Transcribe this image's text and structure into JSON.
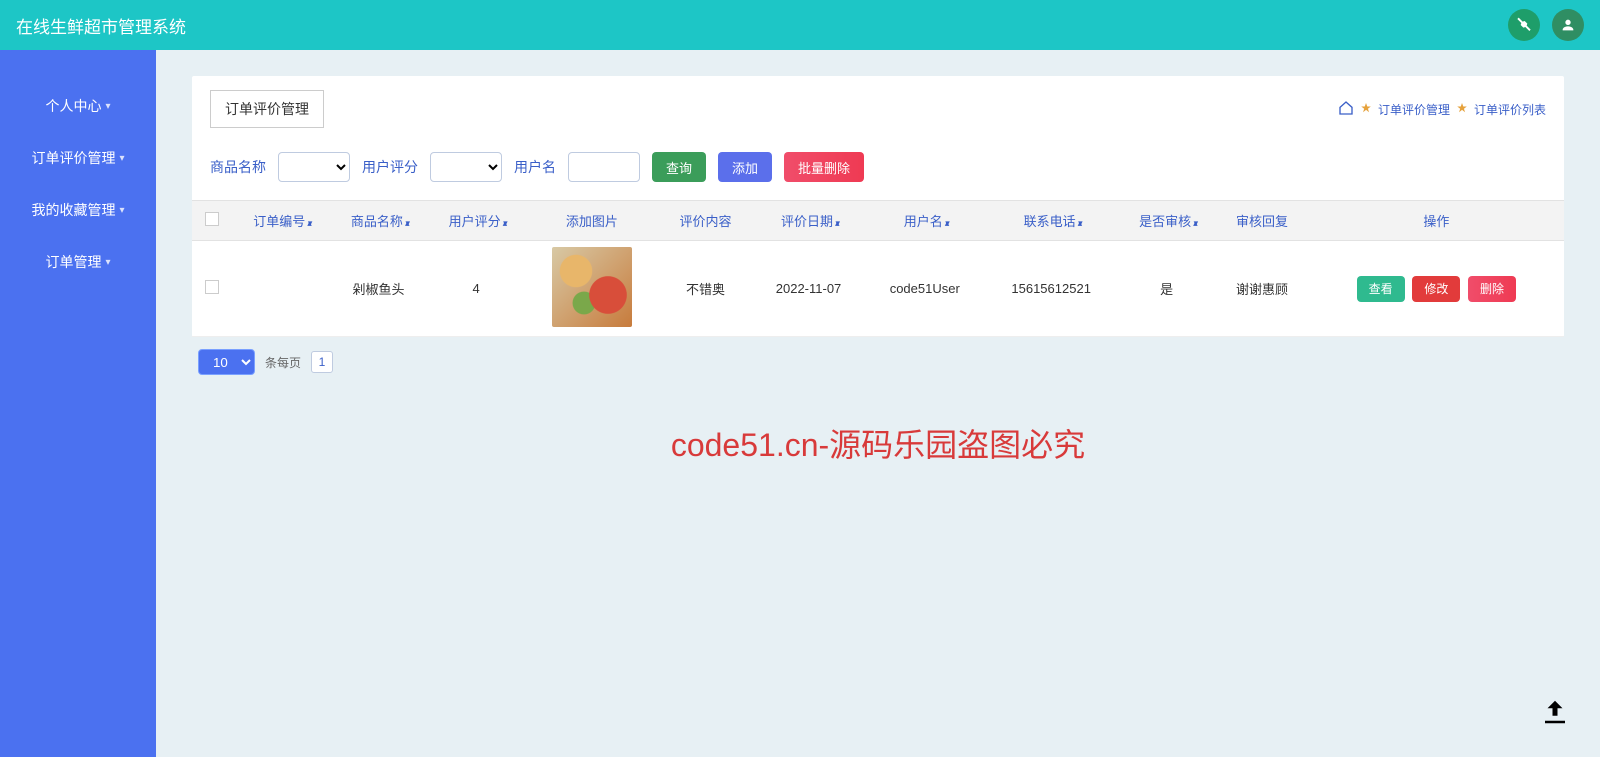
{
  "app_title": "在线生鲜超市管理系统",
  "sidebar": {
    "items": [
      {
        "label": "个人中心"
      },
      {
        "label": "订单评价管理"
      },
      {
        "label": "我的收藏管理"
      },
      {
        "label": "订单管理"
      }
    ]
  },
  "page": {
    "title": "订单评价管理",
    "breadcrumb": [
      "订单评价管理",
      "订单评价列表"
    ]
  },
  "filters": {
    "product_label": "商品名称",
    "rating_label": "用户评分",
    "user_label": "用户名",
    "search_btn": "查询",
    "add_btn": "添加",
    "bulk_delete_btn": "批量删除"
  },
  "table": {
    "headers": [
      "订单编号",
      "商品名称",
      "用户评分",
      "添加图片",
      "评价内容",
      "评价日期",
      "用户名",
      "联系电话",
      "是否审核",
      "审核回复",
      "操作"
    ],
    "rows": [
      {
        "order_no": "",
        "product": "剁椒鱼头",
        "rating": "4",
        "content": "不错奥",
        "date": "2022-11-07",
        "user": "code51User",
        "phone": "15615612521",
        "reviewed": "是",
        "reply": "谢谢惠顾"
      }
    ],
    "ops": {
      "view": "查看",
      "edit": "修改",
      "delete": "删除"
    }
  },
  "pager": {
    "size": "10",
    "per_page_label": "条每页",
    "page": "1"
  },
  "watermark": "code51.cn-源码乐园盗图必究"
}
